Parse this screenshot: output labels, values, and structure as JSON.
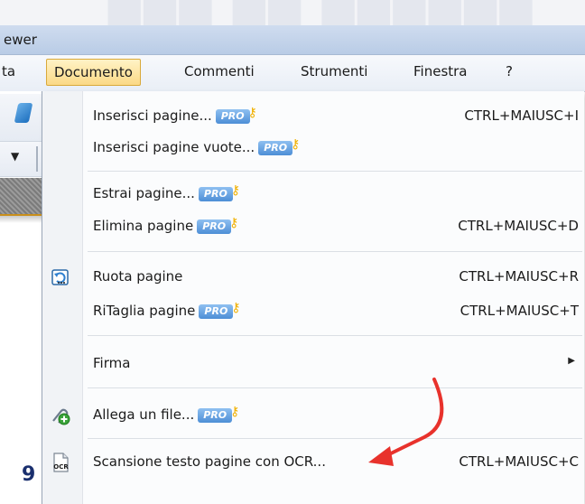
{
  "window": {
    "title_fragment": "ewer"
  },
  "menubar": {
    "items": [
      {
        "label": "ta"
      },
      {
        "label": "Documento"
      },
      {
        "label": "Commenti"
      },
      {
        "label": "Strumenti"
      },
      {
        "label": "Finestra"
      },
      {
        "label": "?"
      }
    ]
  },
  "dropdown": {
    "pro_badge": "PRO",
    "items": [
      {
        "label": "Inserisci pagine...",
        "pro": true,
        "shortcut": "CTRL+MAIUSC+I"
      },
      {
        "label": "Inserisci pagine vuote...",
        "pro": true,
        "shortcut": ""
      },
      {
        "label": "Estrai pagine...",
        "pro": true,
        "shortcut": ""
      },
      {
        "label": "Elimina pagine",
        "pro": true,
        "shortcut": "CTRL+MAIUSC+D"
      },
      {
        "label": "Ruota pagine",
        "pro": false,
        "shortcut": "CTRL+MAIUSC+R",
        "icon": "rotate-page-icon"
      },
      {
        "label": "RiTaglia pagine",
        "pro": true,
        "shortcut": "CTRL+MAIUSC+T"
      },
      {
        "label": "Firma",
        "pro": false,
        "shortcut": "",
        "submenu": true
      },
      {
        "label": "Allega un file...",
        "pro": true,
        "shortcut": "",
        "icon": "attach-file-icon"
      },
      {
        "label": "Scansione testo pagine con OCR...",
        "pro": false,
        "shortcut": "CTRL+MAIUSC+C",
        "icon": "ocr-icon"
      }
    ]
  },
  "background": {
    "number_fragment": "9"
  },
  "colors": {
    "menu_highlight": "#fbd986",
    "pro_badge": "#4d8ed6",
    "arrow": "#e8322c"
  }
}
